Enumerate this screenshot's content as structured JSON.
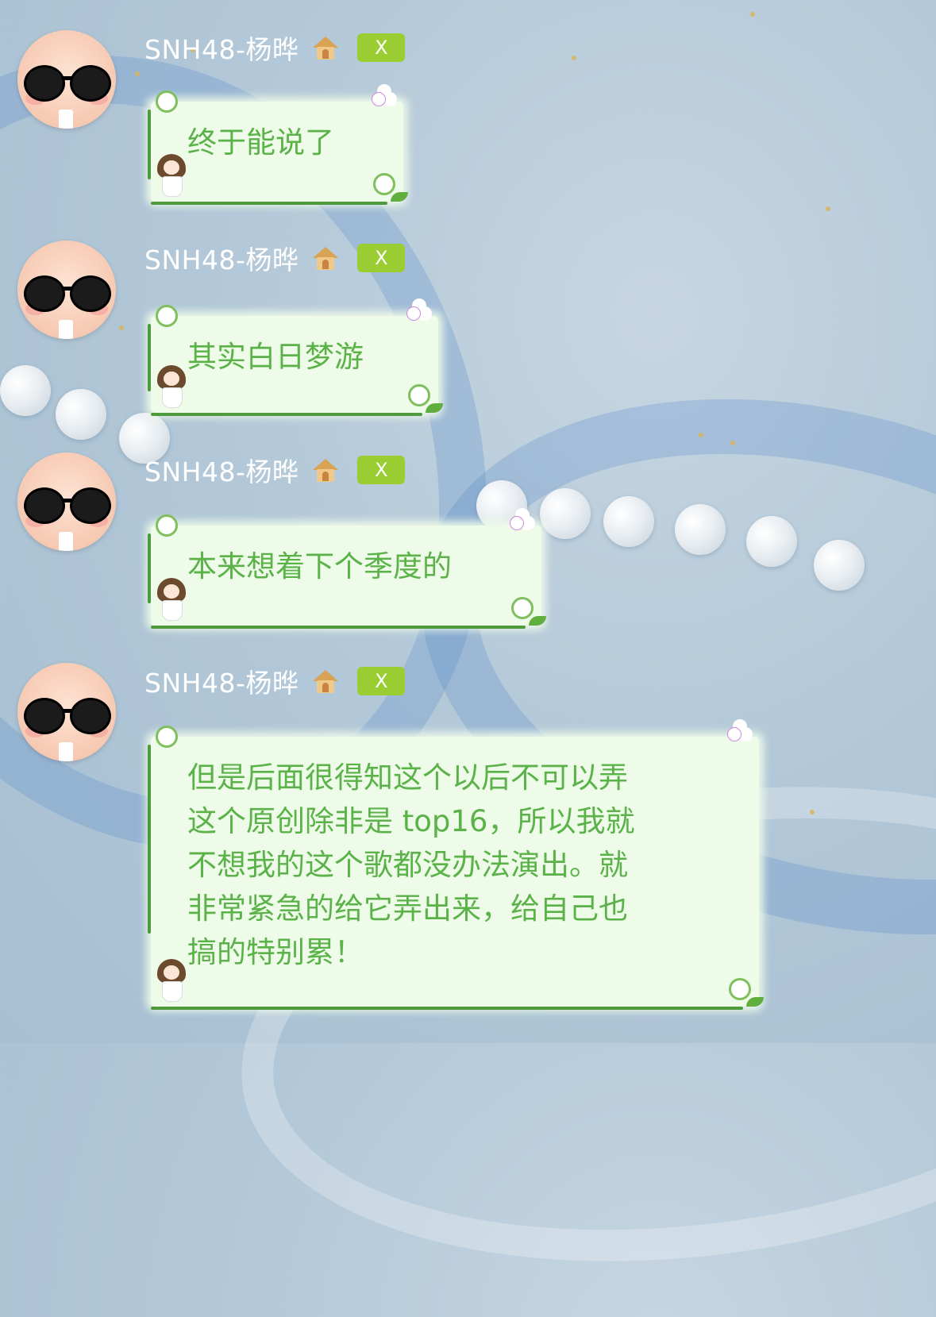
{
  "messages": [
    {
      "sender": "SNH48-杨晔",
      "badge": "X",
      "text": "终于能说了"
    },
    {
      "sender": "SNH48-杨晔",
      "badge": "X",
      "text": "其实白日梦游"
    },
    {
      "sender": "SNH48-杨晔",
      "badge": "X",
      "text": "本来想着下个季度的"
    },
    {
      "sender": "SNH48-杨晔",
      "badge": "X",
      "text": "但是后面很得知这个以后不可以弄\n这个原创除非是 top16，所以我就\n不想我的这个歌都没办法演出。就\n非常紧急的给它弄出来，给自己也\n搞的特别累！"
    }
  ],
  "colors": {
    "name_text": "#ffffff",
    "bubble_bg": "#eefbe9",
    "bubble_text": "#5ab248",
    "badge_bg": "#9acd32"
  },
  "icons": {
    "avatar": "cartoon-face-sunglasses-avatar",
    "role": "house-icon",
    "bubble_decor": "flower-vine-frame"
  }
}
